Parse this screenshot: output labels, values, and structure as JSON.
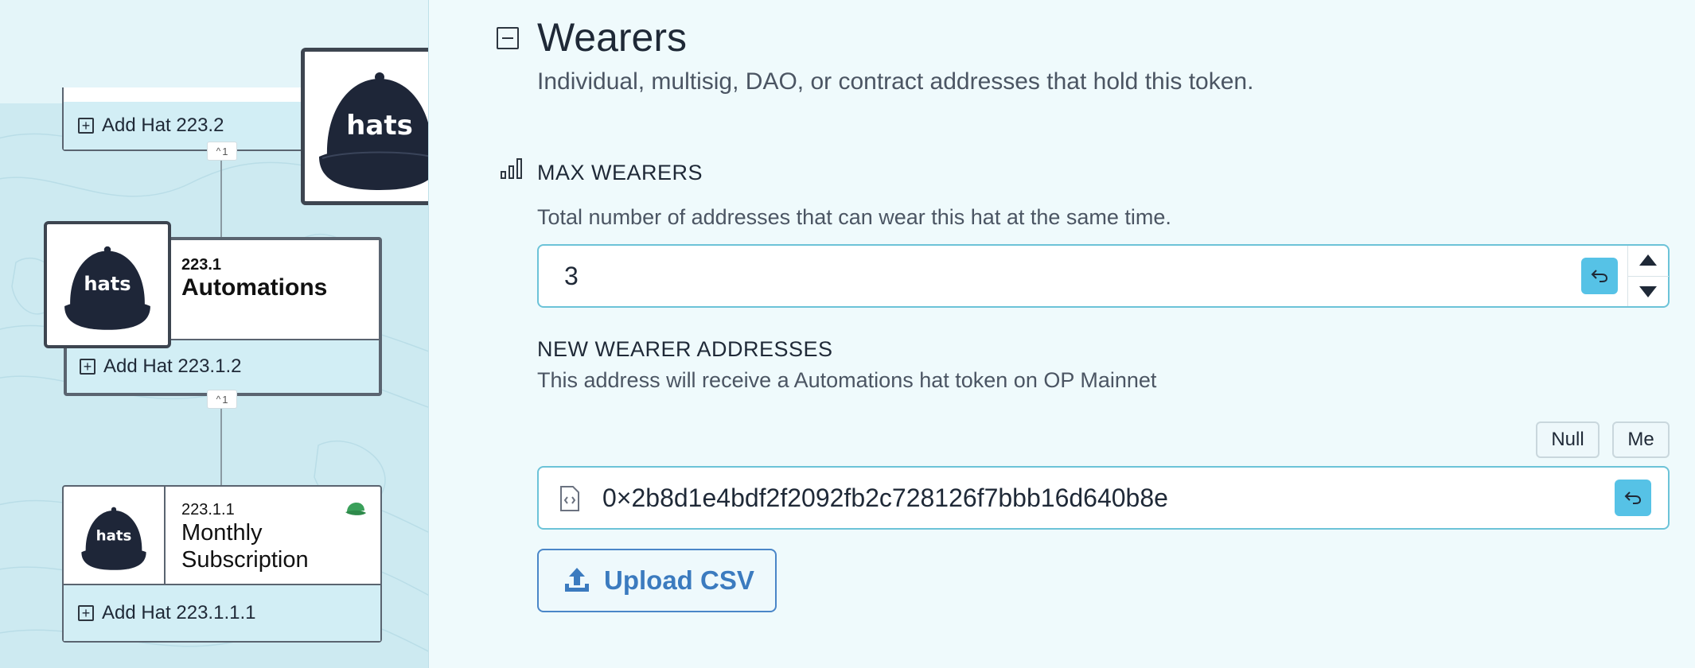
{
  "tree": {
    "add_hat_223_2": "Add Hat 223.2",
    "add_hat_223_1_2": "Add Hat 223.1.2",
    "add_hat_223_1_1_1": "Add Hat 223.1.1.1",
    "collapse_badges": [
      "1",
      "1"
    ],
    "hat_image_text": "hats",
    "selected_hat": {
      "id": "223.1",
      "name": "Automations"
    },
    "child_hat": {
      "id": "223.1.1",
      "name_line1": "Monthly",
      "name_line2": "Subscription"
    }
  },
  "wearers": {
    "title": "Wearers",
    "subtitle": "Individual, multisig, DAO, or contract addresses that hold this token.",
    "max_wearers": {
      "label": "MAX WEARERS",
      "description": "Total number of addresses that can wear this hat at the same time.",
      "value": "3"
    },
    "new_wearers": {
      "label": "NEW WEARER ADDRESSES",
      "description": "This address will receive a Automations hat token on OP Mainnet",
      "null_button": "Null",
      "me_button": "Me",
      "address_value": "0×2b8d1e4bdf2f2092fb2c728126f7bbb16d640b8e"
    },
    "upload_csv_label": "Upload CSV"
  },
  "colors": {
    "accent": "#56c2e6",
    "upload_text": "#3b7bbf",
    "field_border": "#6cc3d8",
    "tree_bg": "#cdeaf1",
    "hat_navy": "#1e2638"
  }
}
